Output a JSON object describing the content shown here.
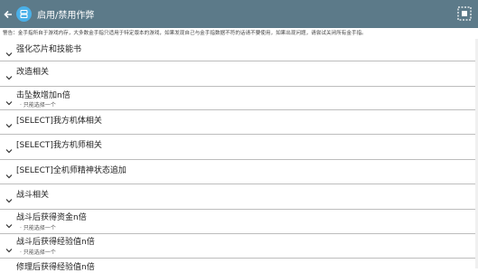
{
  "appbar": {
    "title": "启用/禁用作弊",
    "back_icon": "back-arrow-icon",
    "logo_icon": "app-logo-icon",
    "menu_icon": "select-all-icon"
  },
  "warning": "警告：金手指所自于游戏内存，大多数金手指只适用于特定版本的游戏，如果发现自己与金手指数据不符的话请不要使用，如果出现问题，请尝试关闭所有金手指。",
  "items": [
    {
      "label": "强化芯片和技能书",
      "sub": ""
    },
    {
      "label": "改造相关",
      "sub": ""
    },
    {
      "label": "击坠数增加n倍",
      "sub": "· 只能选择一个"
    },
    {
      "label": "[SELECT]我方机体相关",
      "sub": ""
    },
    {
      "label": "[SELECT]我方机师相关",
      "sub": ""
    },
    {
      "label": "[SELECT]全机师精神状态追加",
      "sub": ""
    },
    {
      "label": "战斗相关",
      "sub": ""
    },
    {
      "label": "战斗后获得资金n倍",
      "sub": "· 只能选择一个"
    },
    {
      "label": "战斗后获得经验值n倍",
      "sub": "· 只能选择一个"
    },
    {
      "label": "修理后获得经验值n倍",
      "sub": ""
    }
  ]
}
